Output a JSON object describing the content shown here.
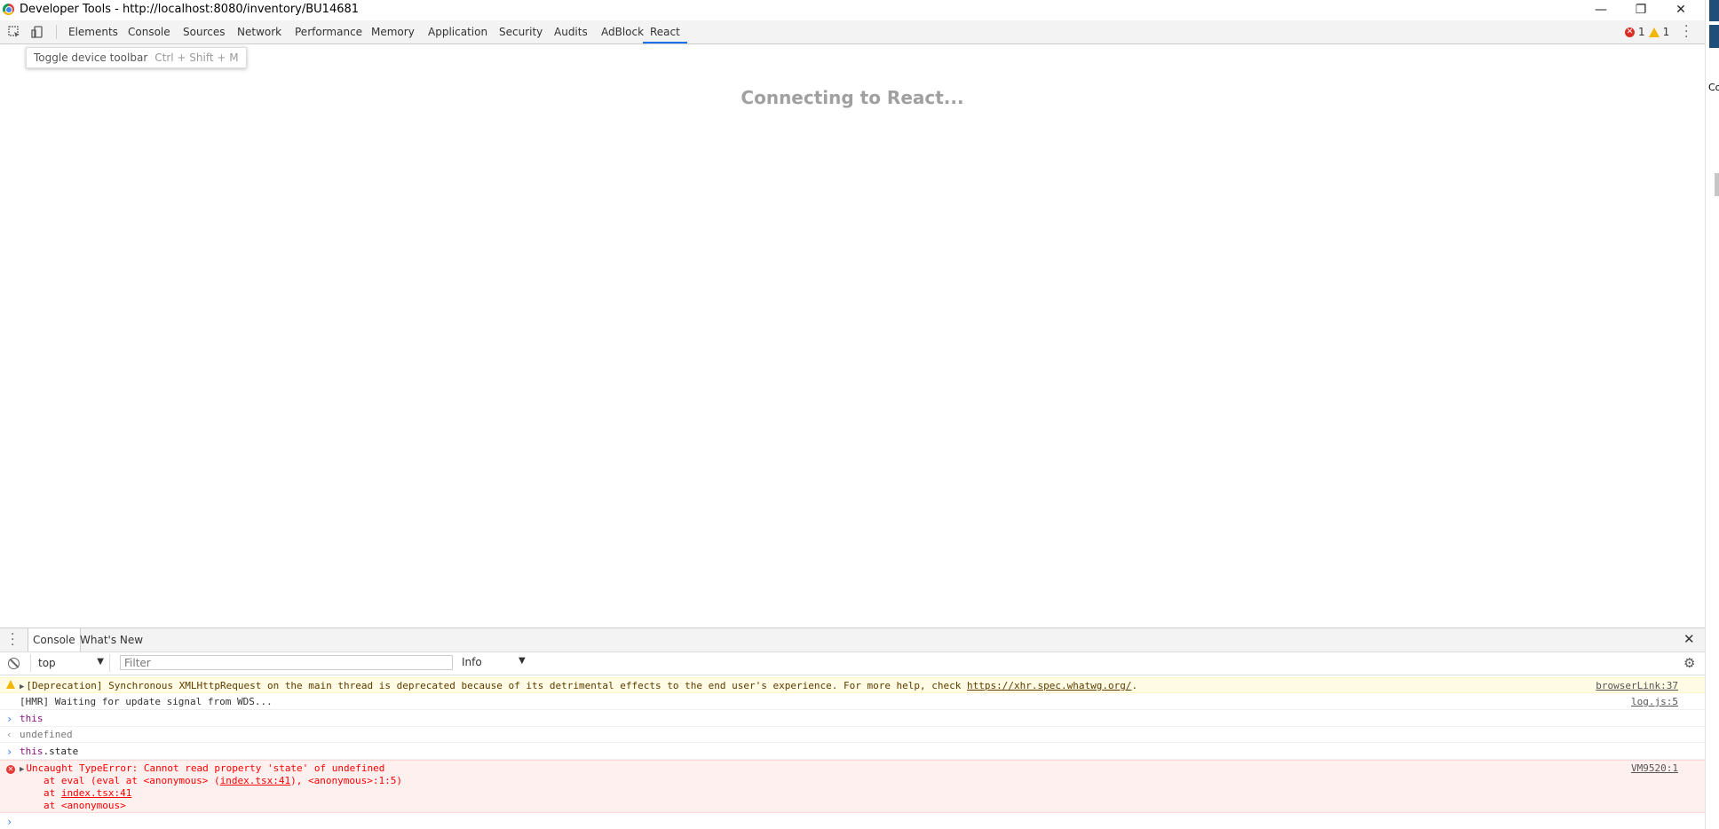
{
  "window": {
    "title": "Developer Tools - http://localhost:8080/inventory/BU14681",
    "minimize": "—",
    "maximize": "❐",
    "close": "✕"
  },
  "tabs": [
    {
      "label": "Elements"
    },
    {
      "label": "Console"
    },
    {
      "label": "Sources"
    },
    {
      "label": "Network"
    },
    {
      "label": "Performance"
    },
    {
      "label": "Memory"
    },
    {
      "label": "Application"
    },
    {
      "label": "Security"
    },
    {
      "label": "Audits"
    },
    {
      "label": "AdBlock"
    },
    {
      "label": "React"
    }
  ],
  "active_tab": "React",
  "issues": {
    "errors": "1",
    "warnings": "1"
  },
  "tooltip": {
    "label": "Toggle device toolbar",
    "shortcut": "Ctrl + Shift + M"
  },
  "main": {
    "status": "Connecting to React..."
  },
  "right_panel": {
    "label": "Co"
  },
  "drawer": {
    "tabs": [
      {
        "label": "Console"
      },
      {
        "label": "What's New"
      }
    ],
    "context": "top",
    "filter_placeholder": "Filter",
    "level": "Info"
  },
  "console": {
    "warning": {
      "text": "[Deprecation] Synchronous XMLHttpRequest on the main thread is deprecated because of its detrimental effects to the end user's experience. For more help, check ",
      "link": "https://xhr.spec.whatwg.org/",
      "trail": ".",
      "source": "browserLink:37"
    },
    "hmr": {
      "text": "[HMR] Waiting for update signal from WDS...",
      "source": "log.js:5"
    },
    "input1": "this",
    "output1": "undefined",
    "input2_keyword": "this",
    "input2_rest": ".state",
    "error": {
      "text": "Uncaught TypeError: Cannot read property 'state' of undefined",
      "source": "VM9520:1",
      "trace1_a": "at eval (eval at <anonymous> (",
      "trace1_link": "index.tsx:41",
      "trace1_b": "), <anonymous>:1:5)",
      "trace2_a": "at ",
      "trace2_link": "index.tsx:41",
      "trace3": "at <anonymous>"
    }
  },
  "colors": {
    "accent": "#1a73e8",
    "error": "#ff0000",
    "warning_bg": "#fffbe5",
    "error_bg": "#fff0f0"
  }
}
